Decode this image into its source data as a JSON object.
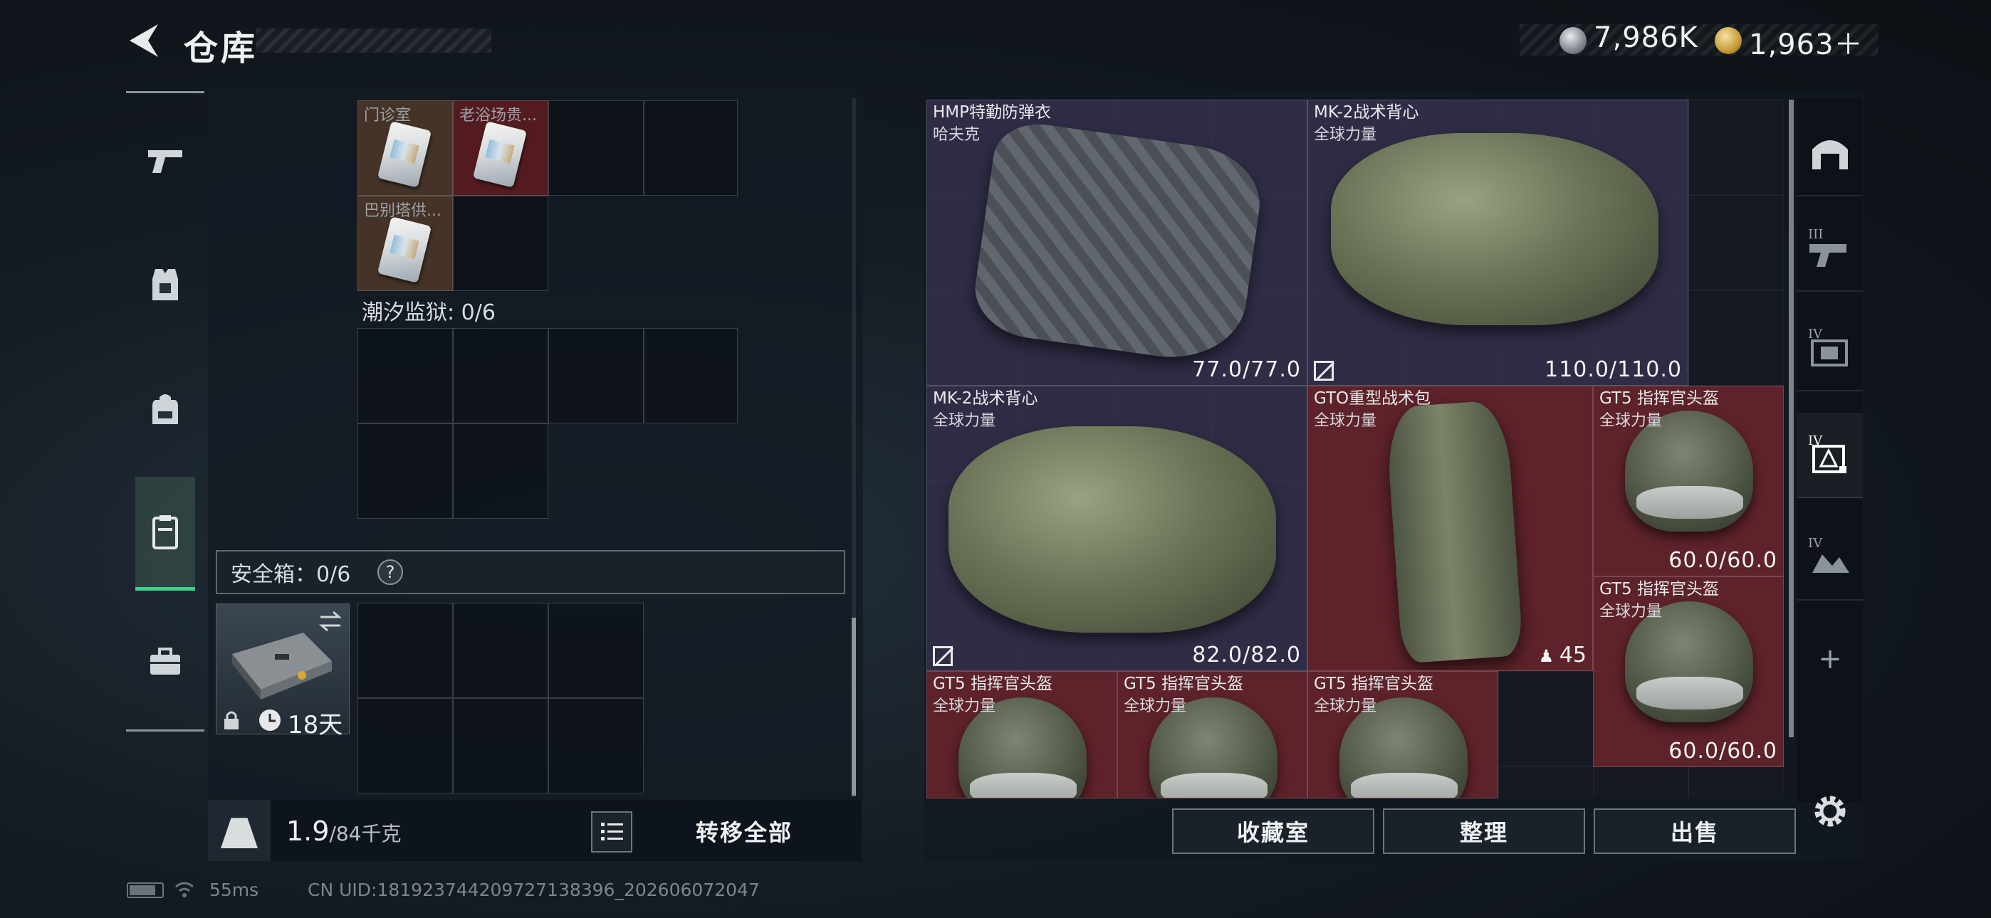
{
  "header": {
    "title": "仓库",
    "currency_silver": "7,986K",
    "currency_gold": "1,963＋"
  },
  "left_nav": [
    {
      "name": "weapons",
      "icon": "pistol-icon"
    },
    {
      "name": "vest",
      "icon": "vest-icon"
    },
    {
      "name": "backpack",
      "icon": "backpack-icon"
    },
    {
      "name": "container",
      "icon": "container-icon",
      "active": true
    },
    {
      "name": "toolbox",
      "icon": "toolbox-icon"
    }
  ],
  "left_panel": {
    "slot_labels": [
      "门诊室",
      "老浴场贵...",
      "巴别塔供..."
    ],
    "prison_label": "潮汐监狱: 0/6",
    "safebox_label": "安全箱：0/6",
    "help": "?",
    "safebox_timer": "18天",
    "weight_value": "1.9",
    "weight_max": "/84千克",
    "transfer_all": "转移全部"
  },
  "right_panel": {
    "items": [
      {
        "name": "HMP特勤防弹衣",
        "sub": "哈夫克",
        "durability": "77.0/77.0"
      },
      {
        "name": "MK-2战术背心",
        "sub": "全球力量",
        "durability": "110.0/110.0"
      },
      {
        "name": "MK-2战术背心",
        "sub": "全球力量",
        "durability": "82.0/82.0"
      },
      {
        "name": "GTO重型战术包",
        "sub": "全球力量",
        "count": "45"
      },
      {
        "name": "GT5 指挥官头盔",
        "sub": "全球力量",
        "durability": "60.0/60.0"
      },
      {
        "name": "GT5 指挥官头盔",
        "sub": "全球力量",
        "durability": "60.0/60.0"
      },
      {
        "name": "GT5 指挥官头盔",
        "sub": "全球力量"
      },
      {
        "name": "GT5 指挥官头盔",
        "sub": "全球力量"
      },
      {
        "name": "GT5 指挥官头盔",
        "sub": "全球力量"
      }
    ],
    "buttons": {
      "collection": "收藏室",
      "sort": "整理",
      "sell": "出售"
    },
    "filters": {
      "tier_3": "III",
      "tier_4a": "IV",
      "tier_4b": "IV",
      "tier_4c": "IV",
      "add": "+"
    }
  },
  "status_bar": {
    "ping": "55ms",
    "uid": "CN UID:18192374420972713839​6_202606072047"
  },
  "colors": {
    "accent_green": "#3fd18a",
    "red_slot": "#6e242c",
    "purple_slot": "#3a3656"
  }
}
